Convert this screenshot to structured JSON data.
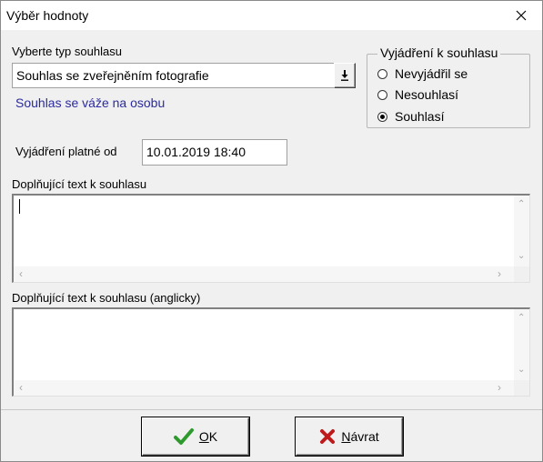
{
  "window": {
    "title": "Výběr hodnoty"
  },
  "consent_type": {
    "label": "Vyberte typ souhlasu",
    "selected": "Souhlas se zveřejněním fotografie",
    "note": "Souhlas se váže na osobu"
  },
  "statement": {
    "legend": "Vyjádření k souhlasu",
    "options": [
      {
        "label": "Nevyjádřil se",
        "checked": false
      },
      {
        "label": "Nesouhlasí",
        "checked": false
      },
      {
        "label": "Souhlasí",
        "checked": true
      }
    ]
  },
  "valid_from": {
    "label": "Vyjádření platné od",
    "value": "10.01.2019 18:40"
  },
  "extra_text": {
    "label": "Doplňující text k souhlasu",
    "value": ""
  },
  "extra_text_en": {
    "label": "Doplňující text k souhlasu (anglicky)",
    "value": ""
  },
  "buttons": {
    "ok": {
      "mnemonic": "O",
      "rest": "K"
    },
    "back": {
      "mnemonic": "N",
      "rest": "ávrat"
    }
  },
  "colors": {
    "ok_check": "#2e9a2e",
    "cancel_x": "#c0191c",
    "link_text": "#2b2b9e"
  },
  "icons": {
    "close": "close-icon",
    "ok": "checkmark-icon",
    "cancel": "red-x-icon",
    "dropdown": "down-arrow-icon"
  }
}
